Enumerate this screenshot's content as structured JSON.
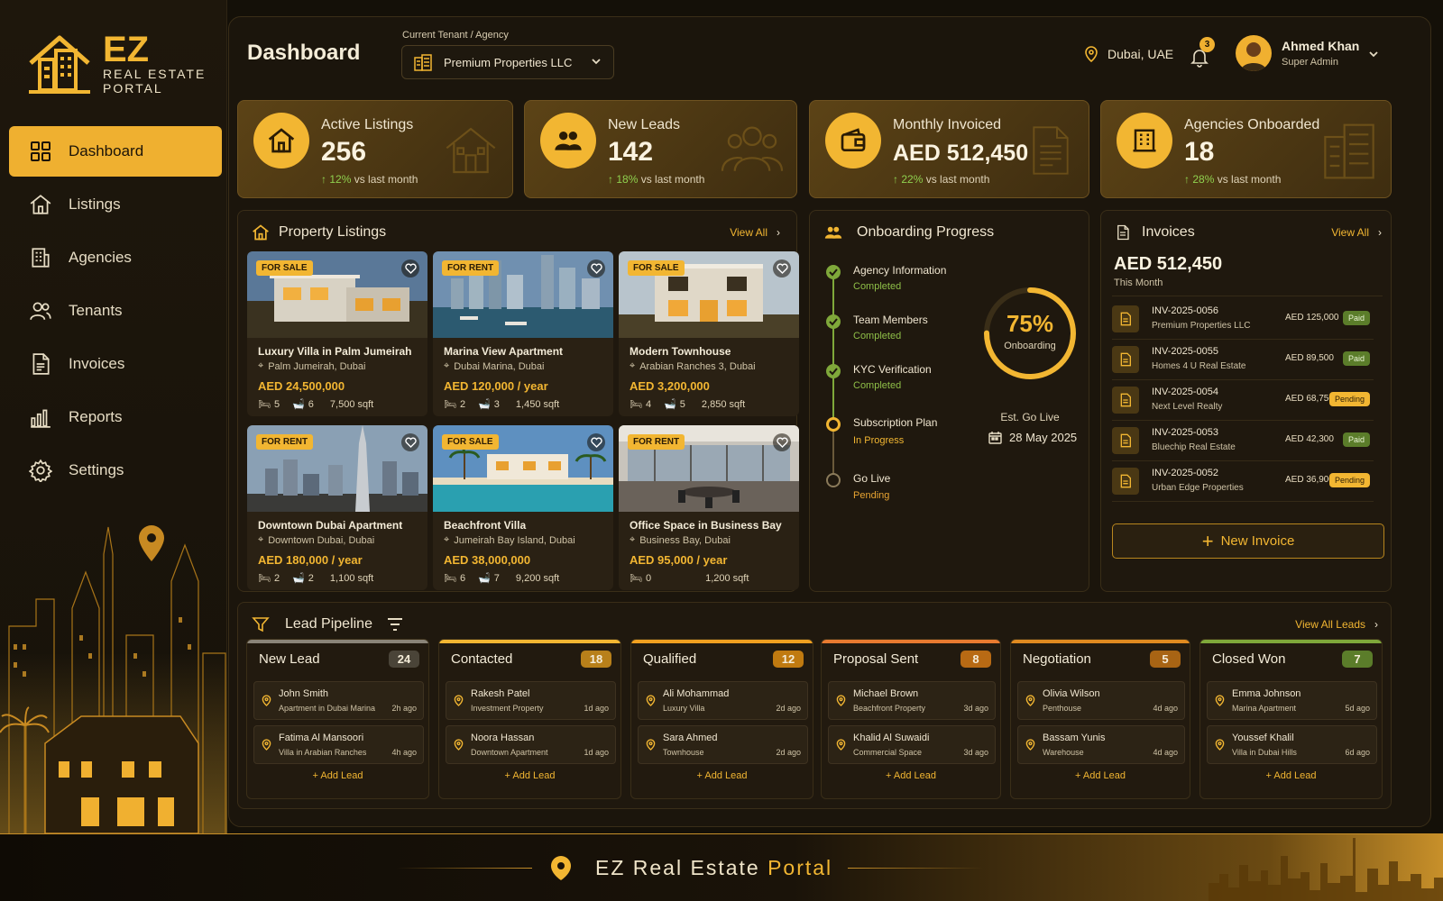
{
  "brand": {
    "name": "EZ",
    "line1": "REAL ESTATE",
    "line2": "PORTAL"
  },
  "sidebar": {
    "items": [
      {
        "label": "Dashboard",
        "icon": "grid-icon",
        "active": true
      },
      {
        "label": "Listings",
        "icon": "house-icon"
      },
      {
        "label": "Agencies",
        "icon": "building-icon"
      },
      {
        "label": "Tenants",
        "icon": "users-icon"
      },
      {
        "label": "Invoices",
        "icon": "document-icon"
      },
      {
        "label": "Reports",
        "icon": "bar-chart-icon"
      },
      {
        "label": "Settings",
        "icon": "gear-icon"
      }
    ]
  },
  "header": {
    "title": "Dashboard",
    "tenant_label": "Current Tenant / Agency",
    "tenant_value": "Premium Properties LLC",
    "location": "Dubai, UAE",
    "notifications": "3",
    "user_name": "Ahmed Khan",
    "user_role": "Super Admin"
  },
  "stats": [
    {
      "label": "Active Listings",
      "value": "256",
      "change": "12%",
      "suffix": "vs last month",
      "icon": "house-icon"
    },
    {
      "label": "New Leads",
      "value": "142",
      "change": "18%",
      "suffix": "vs last month",
      "icon": "users-icon"
    },
    {
      "label": "Monthly Invoiced",
      "value": "AED 512,450",
      "change": "22%",
      "suffix": "vs last month",
      "icon": "wallet-icon"
    },
    {
      "label": "Agencies Onboarded",
      "value": "18",
      "change": "28%",
      "suffix": "vs last month",
      "icon": "building-icon"
    }
  ],
  "listings": {
    "title": "Property Listings",
    "view_all": "View All",
    "items": [
      {
        "tag": "FOR SALE",
        "title": "Luxury Villa in Palm Jumeirah",
        "location": "Palm Jumeirah, Dubai",
        "price": "AED 24,500,000",
        "beds": "5",
        "baths": "6",
        "area": "7,500 sqft"
      },
      {
        "tag": "FOR RENT",
        "title": "Marina View Apartment",
        "location": "Dubai Marina, Dubai",
        "price": "AED 120,000 / year",
        "beds": "2",
        "baths": "3",
        "area": "1,450 sqft"
      },
      {
        "tag": "FOR SALE",
        "title": "Modern Townhouse",
        "location": "Arabian Ranches 3, Dubai",
        "price": "AED 3,200,000",
        "beds": "4",
        "baths": "5",
        "area": "2,850 sqft"
      },
      {
        "tag": "FOR RENT",
        "title": "Downtown Dubai Apartment",
        "location": "Downtown Dubai, Dubai",
        "price": "AED 180,000 / year",
        "beds": "2",
        "baths": "2",
        "area": "1,100 sqft"
      },
      {
        "tag": "FOR SALE",
        "title": "Beachfront Villa",
        "location": "Jumeirah Bay Island, Dubai",
        "price": "AED 38,000,000",
        "beds": "6",
        "baths": "7",
        "area": "9,200 sqft"
      },
      {
        "tag": "FOR RENT",
        "title": "Office Space in Business Bay",
        "location": "Business Bay, Dubai",
        "price": "AED 95,000 / year",
        "beds": "0",
        "baths": "",
        "area": "1,200 sqft"
      }
    ]
  },
  "onboarding": {
    "title": "Onboarding Progress",
    "percent": "75%",
    "percent_value": 75,
    "percent_label": "Onboarding",
    "go_live_label": "Est. Go Live",
    "go_live_date": "28 May 2025",
    "steps": [
      {
        "name": "Agency Information",
        "status": "Completed",
        "state": "done"
      },
      {
        "name": "Team Members",
        "status": "Completed",
        "state": "done"
      },
      {
        "name": "KYC Verification",
        "status": "Completed",
        "state": "done"
      },
      {
        "name": "Subscription Plan",
        "status": "In Progress",
        "state": "progress"
      },
      {
        "name": "Go Live",
        "status": "Pending",
        "state": "pending"
      }
    ]
  },
  "invoices": {
    "title": "Invoices",
    "view_all": "View All",
    "total": "AED 512,450",
    "period": "This Month",
    "new_label": "New Invoice",
    "items": [
      {
        "number": "INV-2025-0056",
        "company": "Premium Properties LLC",
        "amount": "AED 125,000",
        "status": "Paid"
      },
      {
        "number": "INV-2025-0055",
        "company": "Homes 4 U Real Estate",
        "amount": "AED 89,500",
        "status": "Paid"
      },
      {
        "number": "INV-2025-0054",
        "company": "Next Level Realty",
        "amount": "AED 68,750",
        "status": "Pending"
      },
      {
        "number": "INV-2025-0053",
        "company": "Bluechip Real Estate",
        "amount": "AED 42,300",
        "status": "Paid"
      },
      {
        "number": "INV-2025-0052",
        "company": "Urban Edge Properties",
        "amount": "AED 36,900",
        "status": "Pending"
      }
    ]
  },
  "pipeline": {
    "title": "Lead Pipeline",
    "view_all": "View All Leads",
    "add_label": "+ Add Lead",
    "columns": [
      {
        "name": "New Lead",
        "count": "24",
        "color": "#8a8478",
        "badge": "#4a4438",
        "leads": [
          {
            "name": "John Smith",
            "desc": "Apartment in Dubai Marina",
            "time": "2h ago"
          },
          {
            "name": "Fatima Al Mansoori",
            "desc": "Villa in Arabian Ranches",
            "time": "4h ago"
          }
        ]
      },
      {
        "name": "Contacted",
        "count": "18",
        "color": "#f2b632",
        "badge": "#b8801a",
        "leads": [
          {
            "name": "Rakesh Patel",
            "desc": "Investment Property",
            "time": "1d ago"
          },
          {
            "name": "Noora Hassan",
            "desc": "Downtown Apartment",
            "time": "1d ago"
          }
        ]
      },
      {
        "name": "Qualified",
        "count": "12",
        "color": "#f0a020",
        "badge": "#c07a10",
        "leads": [
          {
            "name": "Ali Mohammad",
            "desc": "Luxury Villa",
            "time": "2d ago"
          },
          {
            "name": "Sara Ahmed",
            "desc": "Townhouse",
            "time": "2d ago"
          }
        ]
      },
      {
        "name": "Proposal Sent",
        "count": "8",
        "color": "#e87a30",
        "badge": "#b86a14",
        "leads": [
          {
            "name": "Michael Brown",
            "desc": "Beachfront Property",
            "time": "3d ago"
          },
          {
            "name": "Khalid Al Suwaidi",
            "desc": "Commercial Space",
            "time": "3d ago"
          }
        ]
      },
      {
        "name": "Negotiation",
        "count": "5",
        "color": "#e08a20",
        "badge": "#a86414",
        "leads": [
          {
            "name": "Olivia Wilson",
            "desc": "Penthouse",
            "time": "4d ago"
          },
          {
            "name": "Bassam Yunis",
            "desc": "Warehouse",
            "time": "4d ago"
          }
        ]
      },
      {
        "name": "Closed Won",
        "count": "7",
        "color": "#7fa83a",
        "badge": "#5b7d2a",
        "leads": [
          {
            "name": "Emma Johnson",
            "desc": "Marina Apartment",
            "time": "5d ago"
          },
          {
            "name": "Youssef Khalil",
            "desc": "Villa in Dubai Hills",
            "time": "6d ago"
          }
        ]
      }
    ]
  },
  "footer": {
    "prefix": "EZ Real Estate",
    "suffix": "Portal"
  },
  "colors": {
    "accent": "#f2b632",
    "paid": "#5b7d2a",
    "positive": "#8fd14f"
  }
}
